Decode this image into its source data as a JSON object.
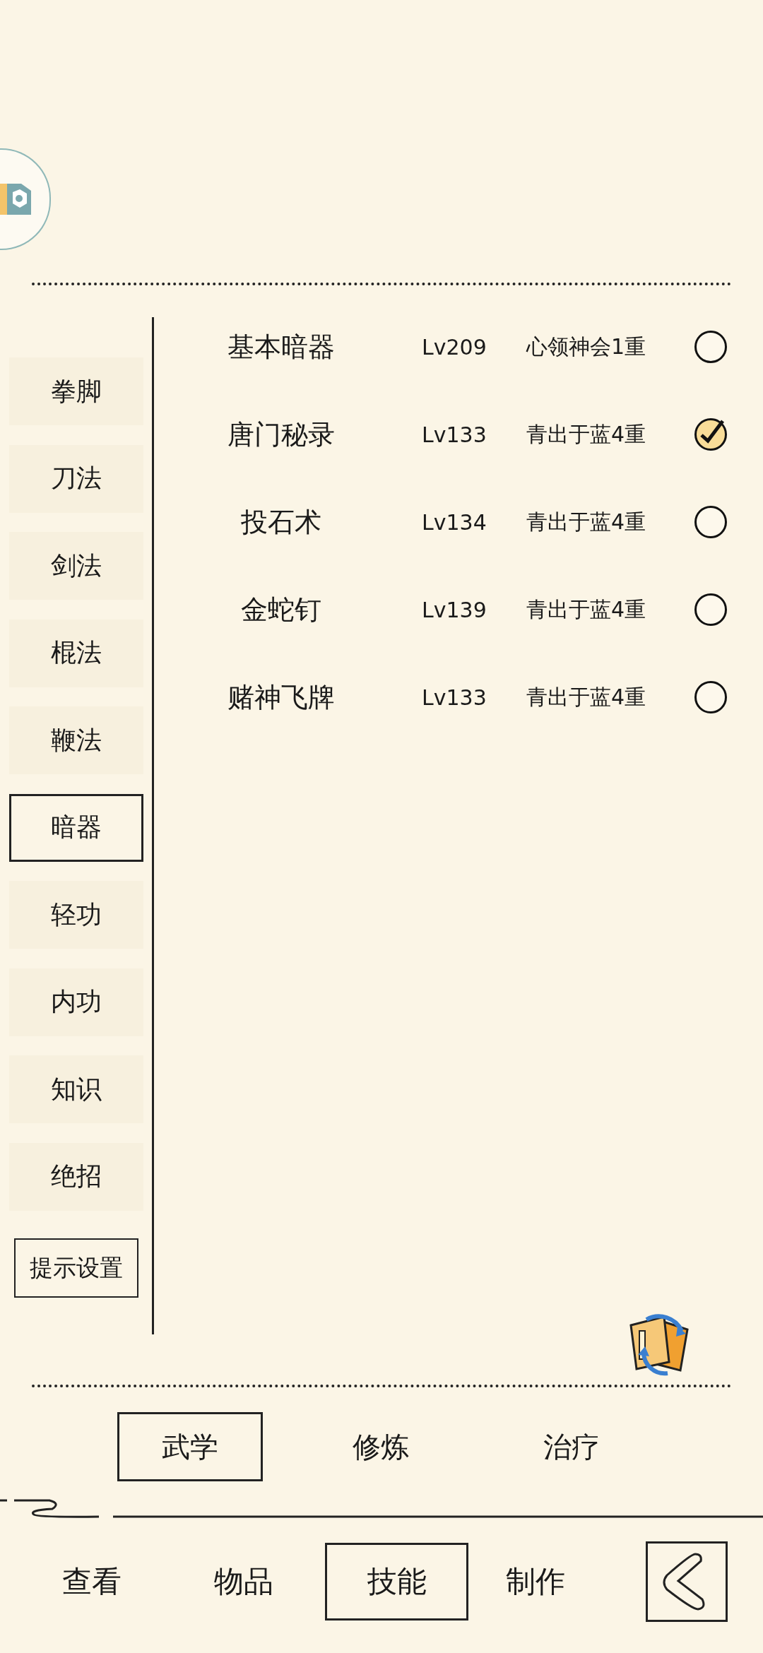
{
  "sidebar": {
    "items": [
      {
        "label": "拳脚",
        "selected": false
      },
      {
        "label": "刀法",
        "selected": false
      },
      {
        "label": "剑法",
        "selected": false
      },
      {
        "label": "棍法",
        "selected": false
      },
      {
        "label": "鞭法",
        "selected": false
      },
      {
        "label": "暗器",
        "selected": true
      },
      {
        "label": "轻功",
        "selected": false
      },
      {
        "label": "内功",
        "selected": false
      },
      {
        "label": "知识",
        "selected": false
      },
      {
        "label": "绝招",
        "selected": false
      }
    ],
    "settings_button": "提示设置"
  },
  "skills": [
    {
      "name": "基本暗器",
      "level": "Lv209",
      "rank": "心领神会1重",
      "checked": false
    },
    {
      "name": "唐门秘录",
      "level": "Lv133",
      "rank": "青出于蓝4重",
      "checked": true
    },
    {
      "name": "投石术",
      "level": "Lv134",
      "rank": "青出于蓝4重",
      "checked": false
    },
    {
      "name": "金蛇钉",
      "level": "Lv139",
      "rank": "青出于蓝4重",
      "checked": false
    },
    {
      "name": "赌神飞牌",
      "level": "Lv133",
      "rank": "青出于蓝4重",
      "checked": false
    }
  ],
  "sub_tabs": [
    {
      "label": "武学",
      "selected": true
    },
    {
      "label": "修炼",
      "selected": false
    },
    {
      "label": "治疗",
      "selected": false
    }
  ],
  "bottom_tabs": [
    {
      "label": "查看",
      "selected": false
    },
    {
      "label": "物品",
      "selected": false
    },
    {
      "label": "技能",
      "selected": true
    },
    {
      "label": "制作",
      "selected": false
    }
  ]
}
